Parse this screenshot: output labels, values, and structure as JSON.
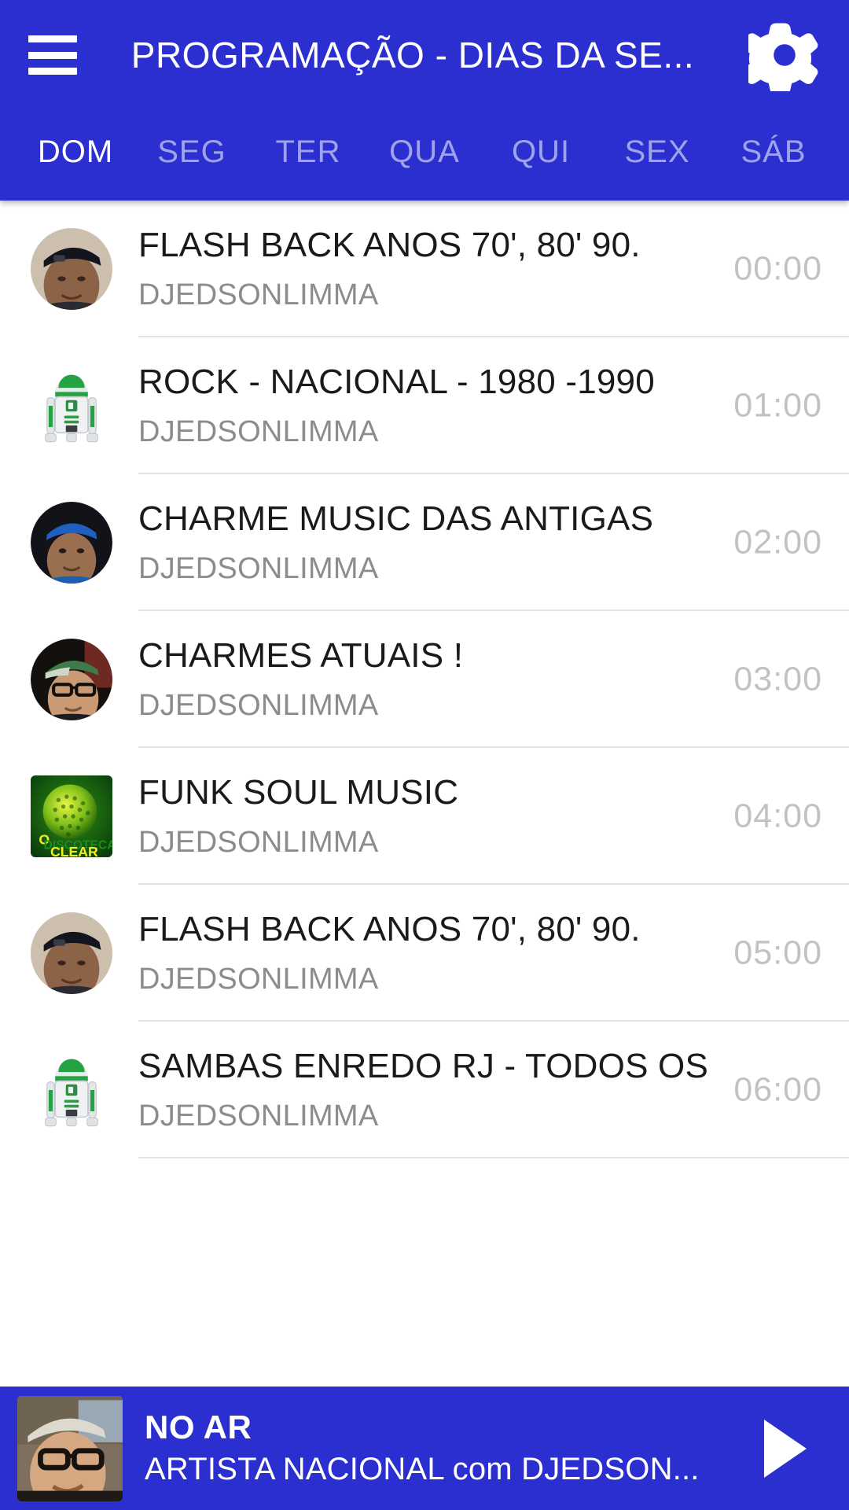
{
  "appbar": {
    "menu_icon": "hamburger-menu-icon",
    "title": "PROGRAMAÇÃO - DIAS DA SE...",
    "settings_icon": "gear-icon",
    "background_color": "#2b2fcf"
  },
  "tabs": {
    "active_index": 0,
    "items": [
      {
        "label": "DOM"
      },
      {
        "label": "SEG"
      },
      {
        "label": "TER"
      },
      {
        "label": "QUA"
      },
      {
        "label": "QUI"
      },
      {
        "label": "SEX"
      },
      {
        "label": "SÁB"
      }
    ]
  },
  "schedule": {
    "rows": [
      {
        "title": "FLASH BACK ANOS 70', 80' 90.",
        "host": "DJEDSONLIMMA",
        "time": "00:00",
        "avatar": "photo-man-black-cap"
      },
      {
        "title": "ROCK - NACIONAL - 1980 -1990",
        "host": "DJEDSONLIMMA",
        "time": "01:00",
        "avatar": "robot-r2d2-green"
      },
      {
        "title": "CHARME MUSIC DAS ANTIGAS",
        "host": "DJEDSONLIMMA",
        "time": "02:00",
        "avatar": "photo-man-blue-cap"
      },
      {
        "title": "CHARMES ATUAIS !",
        "host": "DJEDSONLIMMA",
        "time": "03:00",
        "avatar": "photo-man-green-cap-glasses"
      },
      {
        "title": "FUNK SOUL MUSIC",
        "host": "DJEDSONLIMMA",
        "time": "04:00",
        "avatar": "logo-discoteca-clear"
      },
      {
        "title": "FLASH BACK ANOS 70', 80' 90.",
        "host": "DJEDSONLIMMA",
        "time": "05:00",
        "avatar": "photo-man-black-cap"
      },
      {
        "title": "SAMBAS ENREDO RJ - TODOS OS",
        "host": "DJEDSONLIMMA",
        "time": "06:00",
        "avatar": "robot-r2d2-green"
      }
    ]
  },
  "player": {
    "status_label": "NO AR",
    "track": "ARTISTA NACIONAL com DJEDSON...",
    "play_icon": "play-triangle-icon",
    "thumb": "photo-man-white-cap-glasses",
    "background_color": "#2b2fcf"
  },
  "colors": {
    "brand_blue": "#2b2fcf",
    "title_text": "#1a1a1a",
    "sub_text": "#8c8c8c",
    "time_text": "#c2c2c2",
    "divider": "#e2e2e2"
  }
}
